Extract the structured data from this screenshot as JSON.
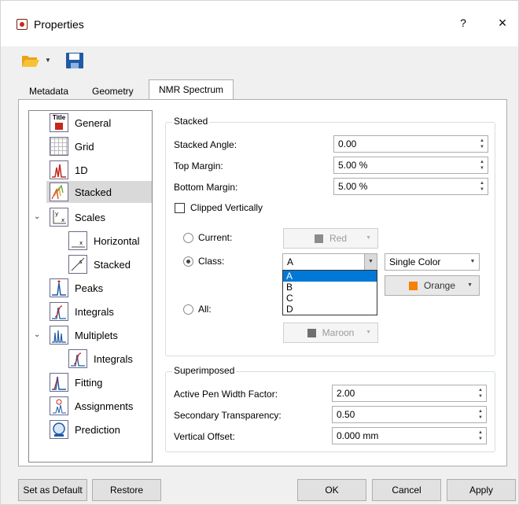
{
  "window": {
    "title": "Properties",
    "help_label": "?",
    "close_label": "×"
  },
  "toolbar": {
    "folder_icon": "folder-open-icon",
    "save_icon": "save-icon"
  },
  "tabs": [
    {
      "label": "Metadata",
      "active": false
    },
    {
      "label": "Geometry",
      "active": false
    },
    {
      "label": "NMR Spectrum",
      "active": true
    }
  ],
  "tree": {
    "items": [
      {
        "label": "General",
        "icon": "title-icon"
      },
      {
        "label": "Grid",
        "icon": "grid-icon"
      },
      {
        "label": "1D",
        "icon": "spectrum-1d-icon"
      },
      {
        "label": "Stacked",
        "icon": "stacked-icon",
        "selected": true
      },
      {
        "label": "Scales",
        "icon": "scales-icon",
        "expanded": true
      },
      {
        "label": "Horizontal",
        "icon": "horizontal-scale-icon"
      },
      {
        "label": "Stacked",
        "icon": "stacked-scale-icon"
      },
      {
        "label": "Peaks",
        "icon": "peaks-icon"
      },
      {
        "label": "Integrals",
        "icon": "integrals-icon"
      },
      {
        "label": "Multiplets",
        "icon": "multiplets-icon",
        "expanded": true
      },
      {
        "label": "Integrals",
        "icon": "integrals-icon"
      },
      {
        "label": "Fitting",
        "icon": "fitting-icon"
      },
      {
        "label": "Assignments",
        "icon": "assignments-icon"
      },
      {
        "label": "Prediction",
        "icon": "prediction-icon"
      }
    ]
  },
  "stacked": {
    "title": "Stacked",
    "angle_label": "Stacked Angle:",
    "angle_value": "0.00",
    "top_margin_label": "Top Margin:",
    "top_margin_value": "5.00 %",
    "bottom_margin_label": "Bottom Margin:",
    "bottom_margin_value": "5.00 %",
    "clipped_label": "Clipped Vertically",
    "current_label": "Current:",
    "current_color": "Red",
    "class_label": "Class:",
    "class_value": "A",
    "class_options": [
      "A",
      "B",
      "C",
      "D"
    ],
    "color_mode": "Single Color",
    "class_color": "Orange",
    "all_label": "All:",
    "all_color": "Maroon"
  },
  "superimposed": {
    "title": "Superimposed",
    "pen_label": "Active Pen Width Factor:",
    "pen_value": "2.00",
    "transparency_label": "Secondary Transparency:",
    "transparency_value": "0.50",
    "offset_label": "Vertical Offset:",
    "offset_value": "0.000 mm"
  },
  "buttons": {
    "set_default": "Set as Default",
    "restore": "Restore",
    "ok": "OK",
    "cancel": "Cancel",
    "apply": "Apply"
  },
  "colors": {
    "red": "#808080",
    "orange": "#f5820a",
    "maroon": "#707070",
    "highlight": "#0078d7"
  }
}
